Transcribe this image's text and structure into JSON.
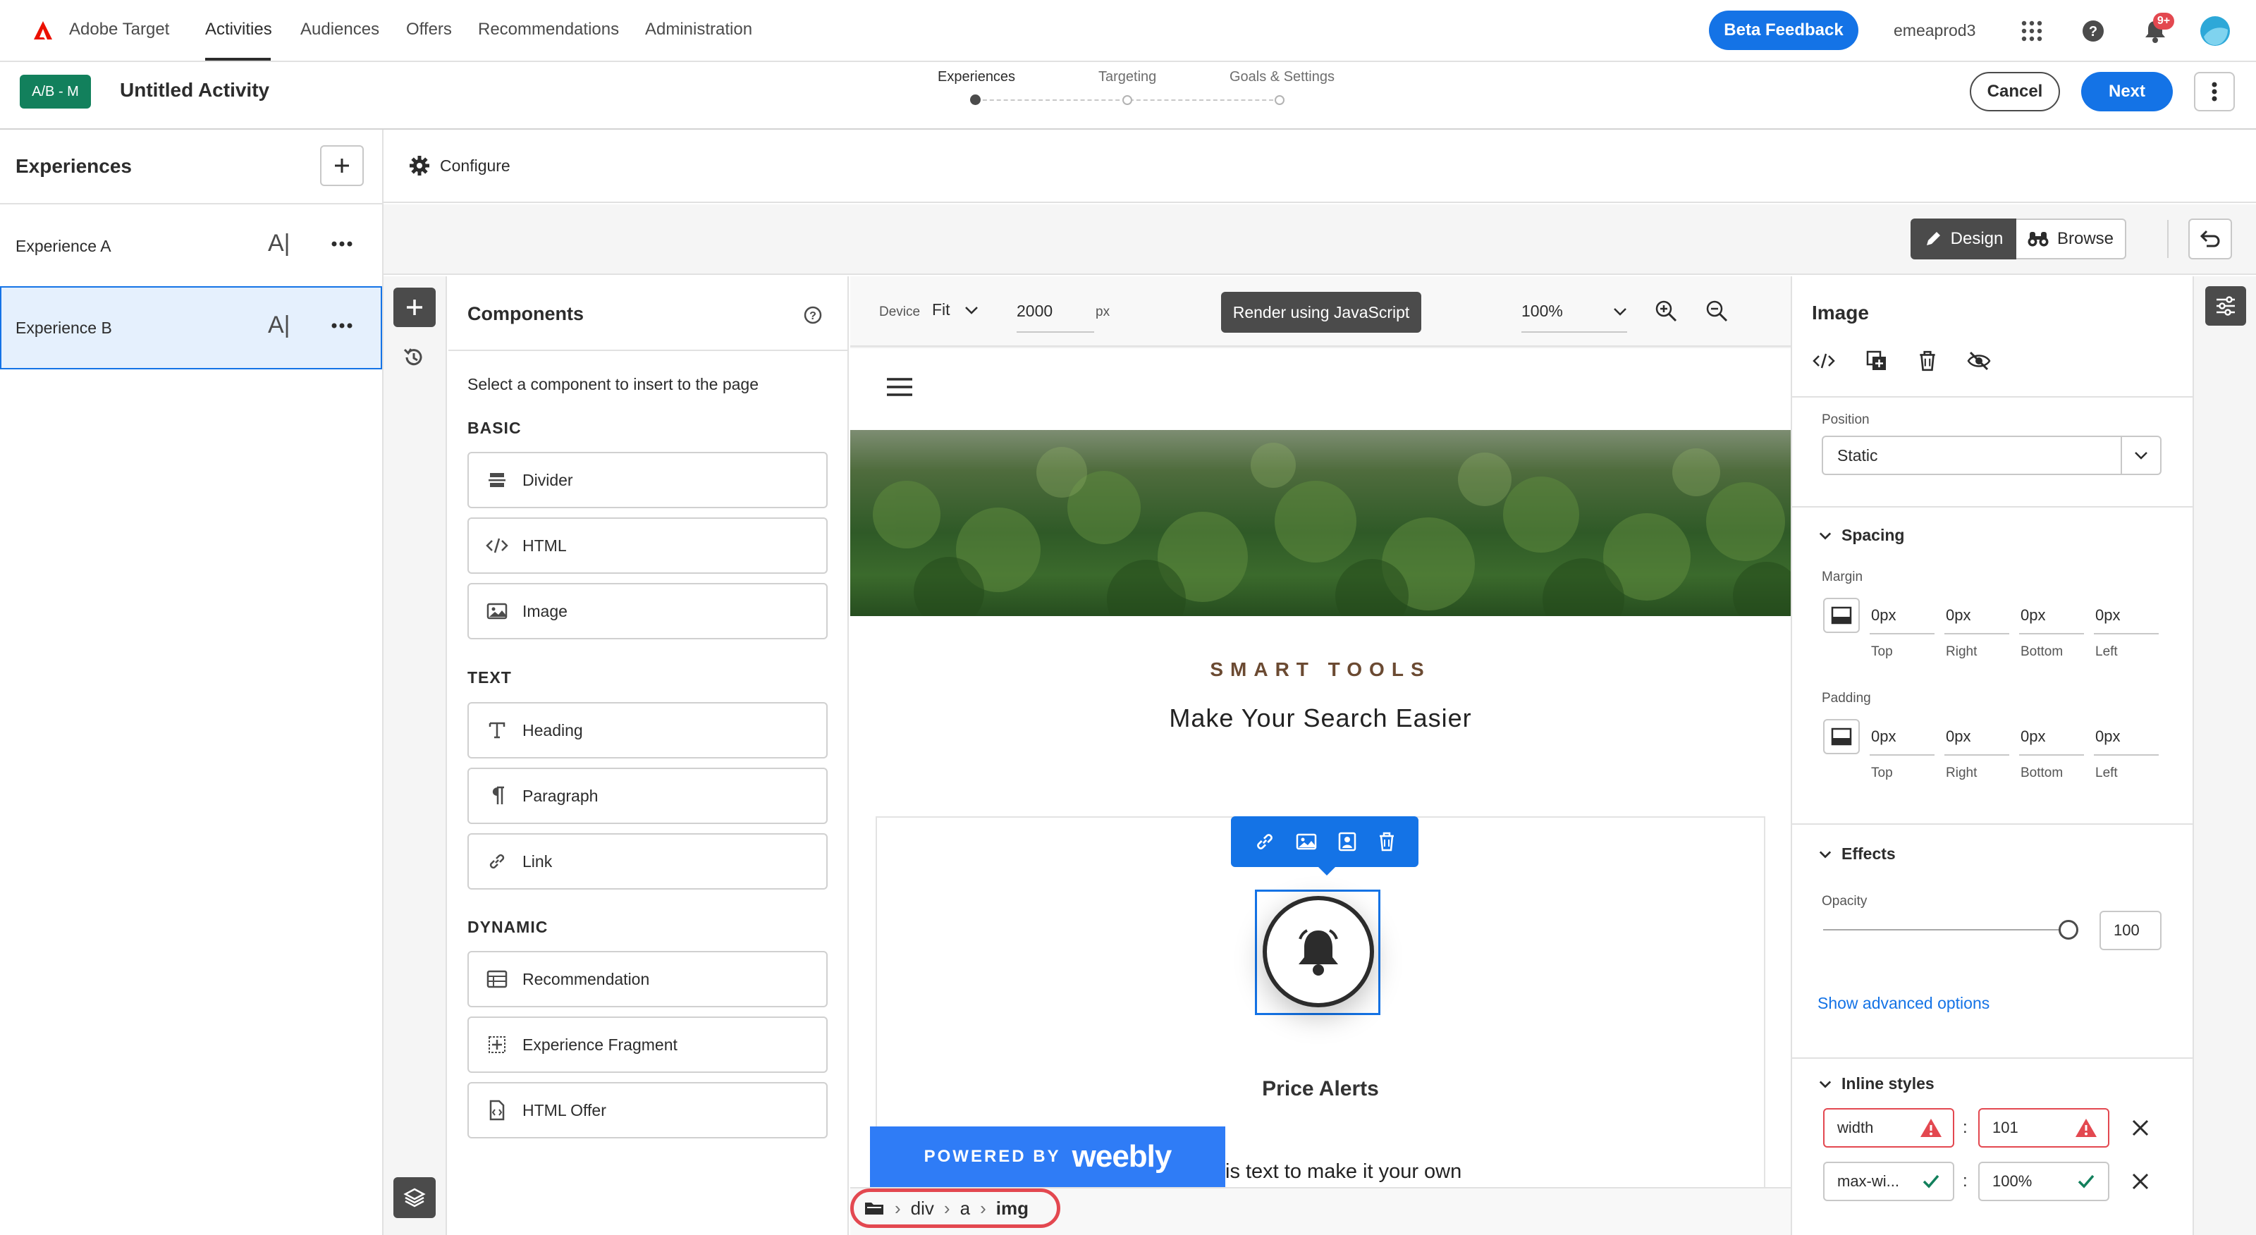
{
  "app": {
    "name": "Adobe Target"
  },
  "nav": {
    "items": [
      "Activities",
      "Audiences",
      "Offers",
      "Recommendations",
      "Administration"
    ],
    "active_index": 0,
    "beta_feedback": "Beta Feedback",
    "org": "emeaprod3",
    "notification_count": "9+"
  },
  "activity": {
    "badge": "A/B - M",
    "title": "Untitled Activity",
    "steps": [
      "Experiences",
      "Targeting",
      "Goals & Settings"
    ],
    "active_step": 0,
    "cancel": "Cancel",
    "next": "Next"
  },
  "experiences": {
    "header": "Experiences",
    "items": [
      {
        "label": "Experience A",
        "selected": false
      },
      {
        "label": "Experience B",
        "selected": true
      }
    ]
  },
  "toolbar": {
    "configure": "Configure",
    "design": "Design",
    "browse": "Browse"
  },
  "components": {
    "title": "Components",
    "hint": "Select a component to insert to the page",
    "sections": [
      {
        "title": "BASIC",
        "items": [
          {
            "label": "Divider",
            "icon": "divider-icon"
          },
          {
            "label": "HTML",
            "icon": "code-icon"
          },
          {
            "label": "Image",
            "icon": "image-icon"
          }
        ]
      },
      {
        "title": "TEXT",
        "items": [
          {
            "label": "Heading",
            "icon": "heading-icon"
          },
          {
            "label": "Paragraph",
            "icon": "paragraph-icon"
          },
          {
            "label": "Link",
            "icon": "link-icon"
          }
        ]
      },
      {
        "title": "DYNAMIC",
        "items": [
          {
            "label": "Recommendation",
            "icon": "recommendation-icon"
          },
          {
            "label": "Experience Fragment",
            "icon": "fragment-icon"
          },
          {
            "label": "HTML Offer",
            "icon": "html-offer-icon"
          }
        ]
      }
    ]
  },
  "canvas": {
    "device_label": "Device",
    "device_value": "Fit",
    "width_value": "2000",
    "width_unit": "px",
    "render_button": "Render using JavaScript",
    "zoom": "100%",
    "page": {
      "eyebrow": "SMART TOOLS",
      "headline": "Make Your Search Easier",
      "card_title": "Price Alerts",
      "body_partial": "is text to make it your own",
      "weebly_powered": "POWERED BY",
      "weebly_brand": "weebly"
    },
    "breadcrumb": [
      "div",
      "a",
      "img"
    ]
  },
  "inspector": {
    "title": "Image",
    "position_label": "Position",
    "position_value": "Static",
    "spacing_title": "Spacing",
    "margin_label": "Margin",
    "padding_label": "Padding",
    "margin": [
      {
        "value": "0px",
        "label": "Top"
      },
      {
        "value": "0px",
        "label": "Right"
      },
      {
        "value": "0px",
        "label": "Bottom"
      },
      {
        "value": "0px",
        "label": "Left"
      }
    ],
    "padding": [
      {
        "value": "0px",
        "label": "Top"
      },
      {
        "value": "0px",
        "label": "Right"
      },
      {
        "value": "0px",
        "label": "Bottom"
      },
      {
        "value": "0px",
        "label": "Left"
      }
    ],
    "effects_title": "Effects",
    "opacity_label": "Opacity",
    "opacity_value": "100",
    "advanced_link": "Show advanced options",
    "inline_title": "Inline styles",
    "inline_styles": [
      {
        "prop": "width",
        "value": "101",
        "status": "warning"
      },
      {
        "prop": "max-wi...",
        "value": "100%",
        "status": "valid"
      }
    ]
  },
  "colors": {
    "brand_red": "#eb1000",
    "primary_blue": "#1473e6",
    "badge_green": "#12805c",
    "weebly_blue": "#2f7cf6",
    "highlight_red": "#e34850",
    "selected_bg": "#e5f0fd"
  }
}
